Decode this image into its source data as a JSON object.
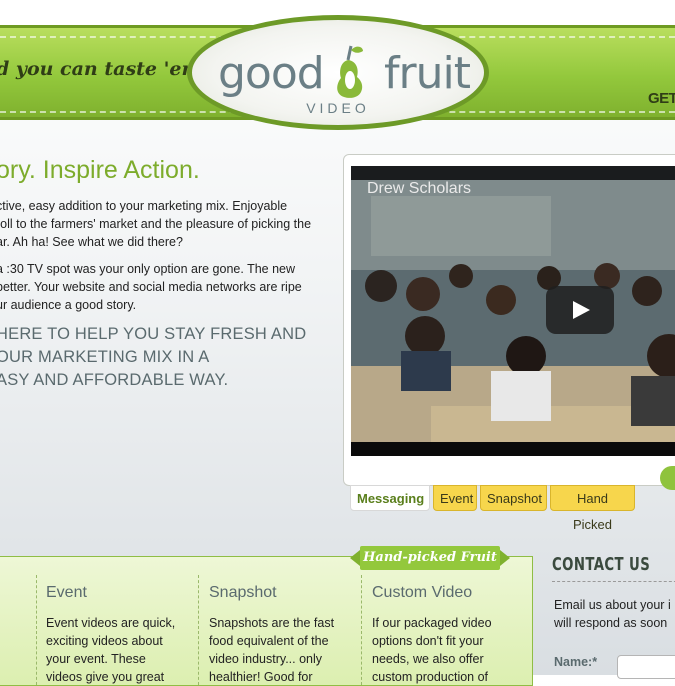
{
  "header": {
    "tagline": "d you can taste 'em",
    "logo_word_good": "good",
    "logo_word_fruit": "fruit",
    "logo_sub": "VIDEO",
    "get_link": "GET"
  },
  "intro": {
    "headline": "ory. Inspire Action.",
    "paragraph1": [
      "ctive, easy addition to your marketing mix. Enjoyable",
      "roll to the farmers' market and the pleasure of picking the",
      "ar. Ah ha! See what we did there?"
    ],
    "paragraph2": [
      "a :30 TV spot was your only option are gone. The new",
      " better. Your website and social media networks are ripe",
      "ur audience a good story."
    ],
    "cta": [
      "HERE TO HELP YOU STAY FRESH AND",
      "OUR MARKETING MIX IN A",
      "ASY AND AFFORDABLE WAY."
    ]
  },
  "video": {
    "title": "Drew Scholars",
    "tabs": [
      "Messaging",
      "Event",
      "Snapshot",
      "Hand Picked"
    ],
    "active_tab": "Messaging"
  },
  "services": {
    "badge": "Hand-picked Fruit",
    "columns": [
      {
        "title": "Event",
        "text": [
          "Event videos are quick,",
          "exciting videos about",
          "your event. These",
          "videos give you great"
        ]
      },
      {
        "title": "Snapshot",
        "text": [
          "Snapshots are the fast",
          "food equivalent of the",
          "video industry... only",
          "healthier! Good for"
        ]
      },
      {
        "title": "Custom Video",
        "text": [
          "If our packaged video",
          "options don't fit your",
          "needs, we also offer",
          "custom production of"
        ]
      }
    ]
  },
  "contact": {
    "title": "CONTACT US",
    "text": [
      "Email us about your i",
      "will respond as soon"
    ],
    "name_label": "Name:*",
    "name_value": ""
  },
  "colors": {
    "brand_green": "#93c83c",
    "headline_green": "#7dac2c",
    "tab_yellow": "#f7d64c"
  }
}
